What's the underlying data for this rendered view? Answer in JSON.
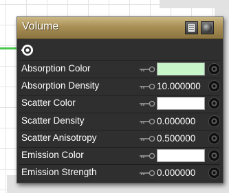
{
  "node": {
    "title": "Volume",
    "header_color": "#a88f55",
    "header_icons": [
      "menu-icon",
      "preview-sphere-icon"
    ],
    "output_icon": "output-socket-icon",
    "properties": [
      {
        "label": "Absorption Color",
        "type": "color",
        "color": "#c8f5c9"
      },
      {
        "label": "Absorption Density",
        "type": "number",
        "value": "10.000000"
      },
      {
        "label": "Scatter Color",
        "type": "color",
        "color": "#ffffff"
      },
      {
        "label": "Scatter Density",
        "type": "number",
        "value": "0.000000"
      },
      {
        "label": "Scatter Anisotropy",
        "type": "number",
        "value": "0.500000"
      },
      {
        "label": "Emission Color",
        "type": "color",
        "color": "#ffffff"
      },
      {
        "label": "Emission Strength",
        "type": "number",
        "value": "0.000000"
      }
    ]
  },
  "connection_color": "#49c84b"
}
